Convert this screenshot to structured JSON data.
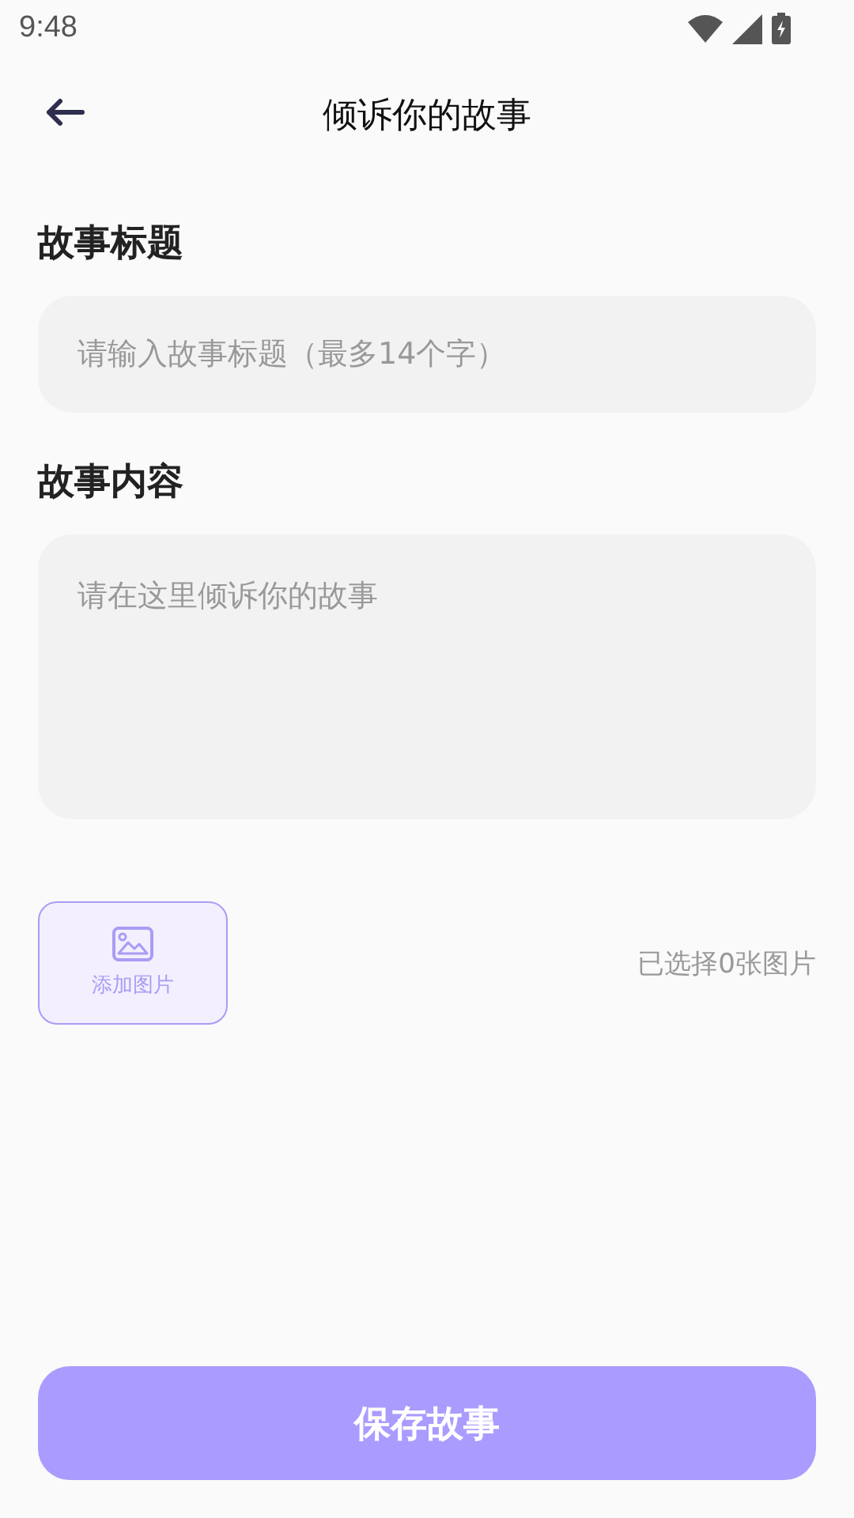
{
  "status_bar": {
    "time": "9:48"
  },
  "header": {
    "title": "倾诉你的故事"
  },
  "title_section": {
    "label": "故事标题",
    "placeholder": "请输入故事标题（最多14个字）"
  },
  "content_section": {
    "label": "故事内容",
    "placeholder": "请在这里倾诉你的故事"
  },
  "images": {
    "add_label": "添加图片",
    "count_text": "已选择0张图片"
  },
  "save_button": {
    "label": "保存故事"
  }
}
